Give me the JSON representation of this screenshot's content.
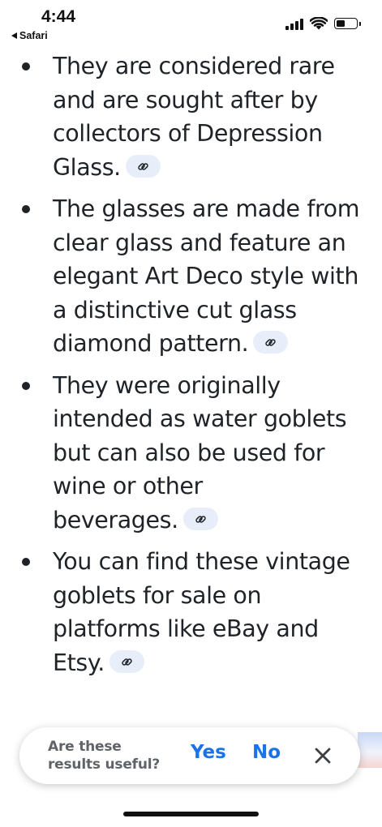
{
  "status_bar": {
    "time": "4:44",
    "back_app": "Safari",
    "battery_level": 0.45
  },
  "list": {
    "items": [
      {
        "lines": [
          "They are considered rare",
          "and are sought after by",
          "collectors of Depression"
        ],
        "last": "Glass."
      },
      {
        "lines": [
          "The glasses are made from",
          "clear glass and feature an",
          "elegant Art Deco style with",
          "a distinctive cut glass"
        ],
        "last": "diamond pattern."
      },
      {
        "lines": [
          "They were originally",
          "intended as water goblets",
          "but can also be used for",
          "wine or other"
        ],
        "last": "beverages."
      },
      {
        "lines": [
          "You can find these vintage",
          "goblets for sale on",
          "platforms like eBay and"
        ],
        "last": "Etsy."
      }
    ],
    "link_icon": "link-icon"
  },
  "feedback": {
    "question_line1": "Are these",
    "question_line2": "results useful?",
    "yes_label": "Yes",
    "no_label": "No",
    "close_icon": "close-icon"
  },
  "colors": {
    "accent": "#1a73e8",
    "text": "#1f2328",
    "chip_bg": "#e8eef9",
    "muted": "#606368"
  }
}
